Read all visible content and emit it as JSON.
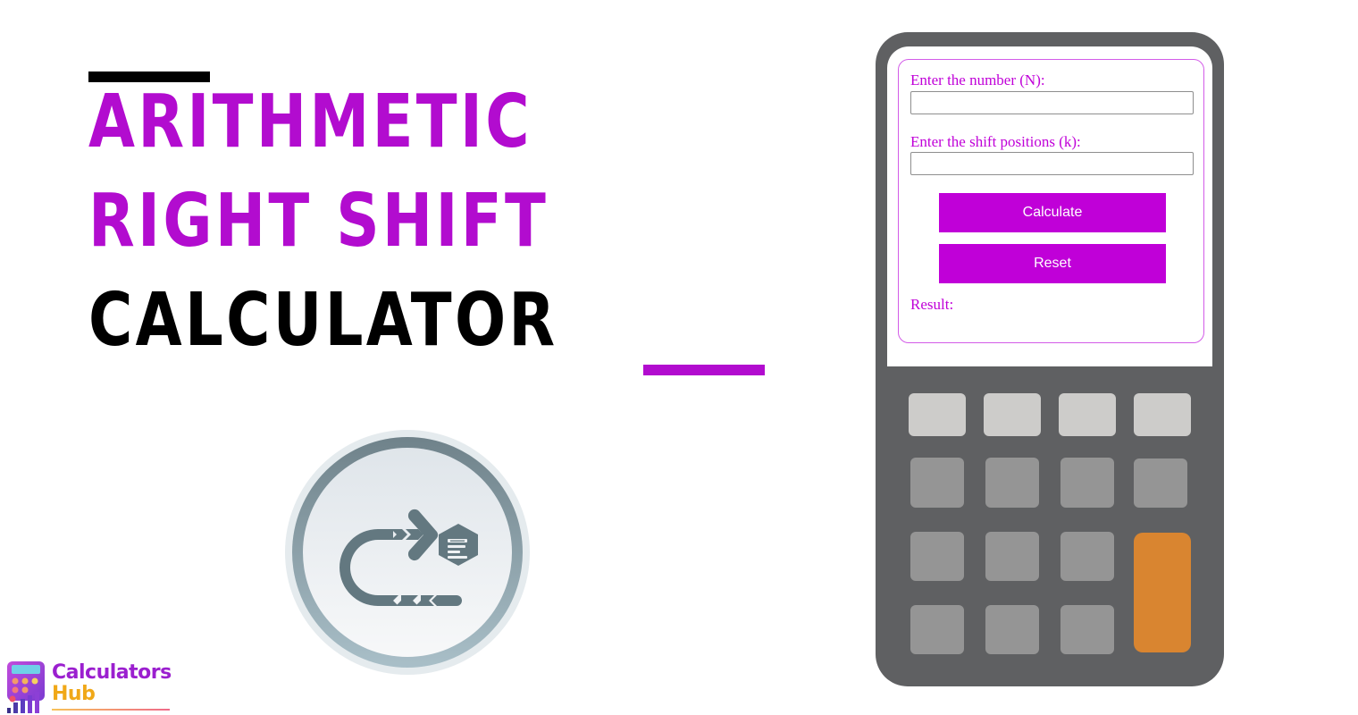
{
  "title": {
    "line1": "ARITHMETIC",
    "line2": "RIGHT SHIFT",
    "line3": "CALCULATOR"
  },
  "colors": {
    "accent": "#b20ccf",
    "button": "#c000d8",
    "calculator_body": "#5f6062",
    "key_light": "#cdccca",
    "key_mid": "#959595",
    "key_equals": "#d98530",
    "icon_gray": "#637880"
  },
  "icon": {
    "name": "arithmetic-right-shift-icon"
  },
  "form": {
    "number_label": "Enter the number (N):",
    "number_value": "",
    "shift_label": "Enter the shift positions (k):",
    "shift_value": "",
    "calculate_label": "Calculate",
    "reset_label": "Reset",
    "result_label": "Result:",
    "result_value": ""
  },
  "keypad": {
    "rows": 4,
    "columns": 4
  },
  "logo": {
    "line1": "Calculators",
    "line2": "Hub"
  }
}
